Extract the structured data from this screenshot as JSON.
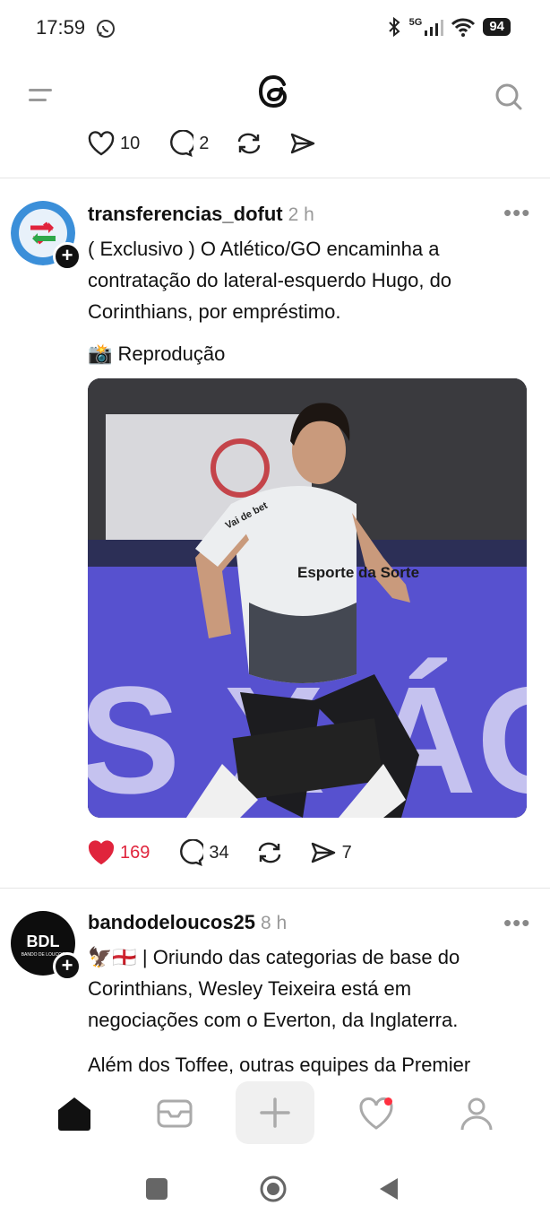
{
  "status_bar": {
    "time": "17:59",
    "network": "5G",
    "battery": "94"
  },
  "header": {
    "menu": "menu-icon",
    "logo": "threads-logo",
    "search": "search-icon"
  },
  "previous_post": {
    "likes": "10",
    "replies": "2"
  },
  "posts": [
    {
      "username": "transferencias_dofut",
      "time": "2 h",
      "text": "( Exclusivo ) O Atlético/GO encaminha a contratação do lateral-esquerdo Hugo, do Corinthians, por empréstimo.",
      "caption": "📸 Reprodução",
      "media_text": {
        "sponsor": "Esporte da Sorte",
        "sleeve": "Vai de bet",
        "banner": "S X ÁGUA"
      },
      "likes": "169",
      "replies": "34",
      "shares": "7",
      "liked": true
    },
    {
      "username": "bandodeloucos25",
      "time": "8 h",
      "avatar_text": "BDL",
      "avatar_subtext": "BANDO DE LOUCOS",
      "text": "🦅🏴󠁧󠁢󠁥󠁮󠁧󠁿 | Oriundo das categorias de base do Corinthians, Wesley Teixeira está em negociações com o Everton, da Inglaterra.",
      "text2": "Além dos Toffee, outras equipes da Premier"
    }
  ],
  "bottom_nav": [
    "home-icon",
    "inbox-icon",
    "compose-icon",
    "activity-icon",
    "profile-icon"
  ],
  "colors": {
    "like_red": "#e0243c",
    "notif_dot": "#ff3040",
    "text": "#111111",
    "muted": "#999999"
  }
}
